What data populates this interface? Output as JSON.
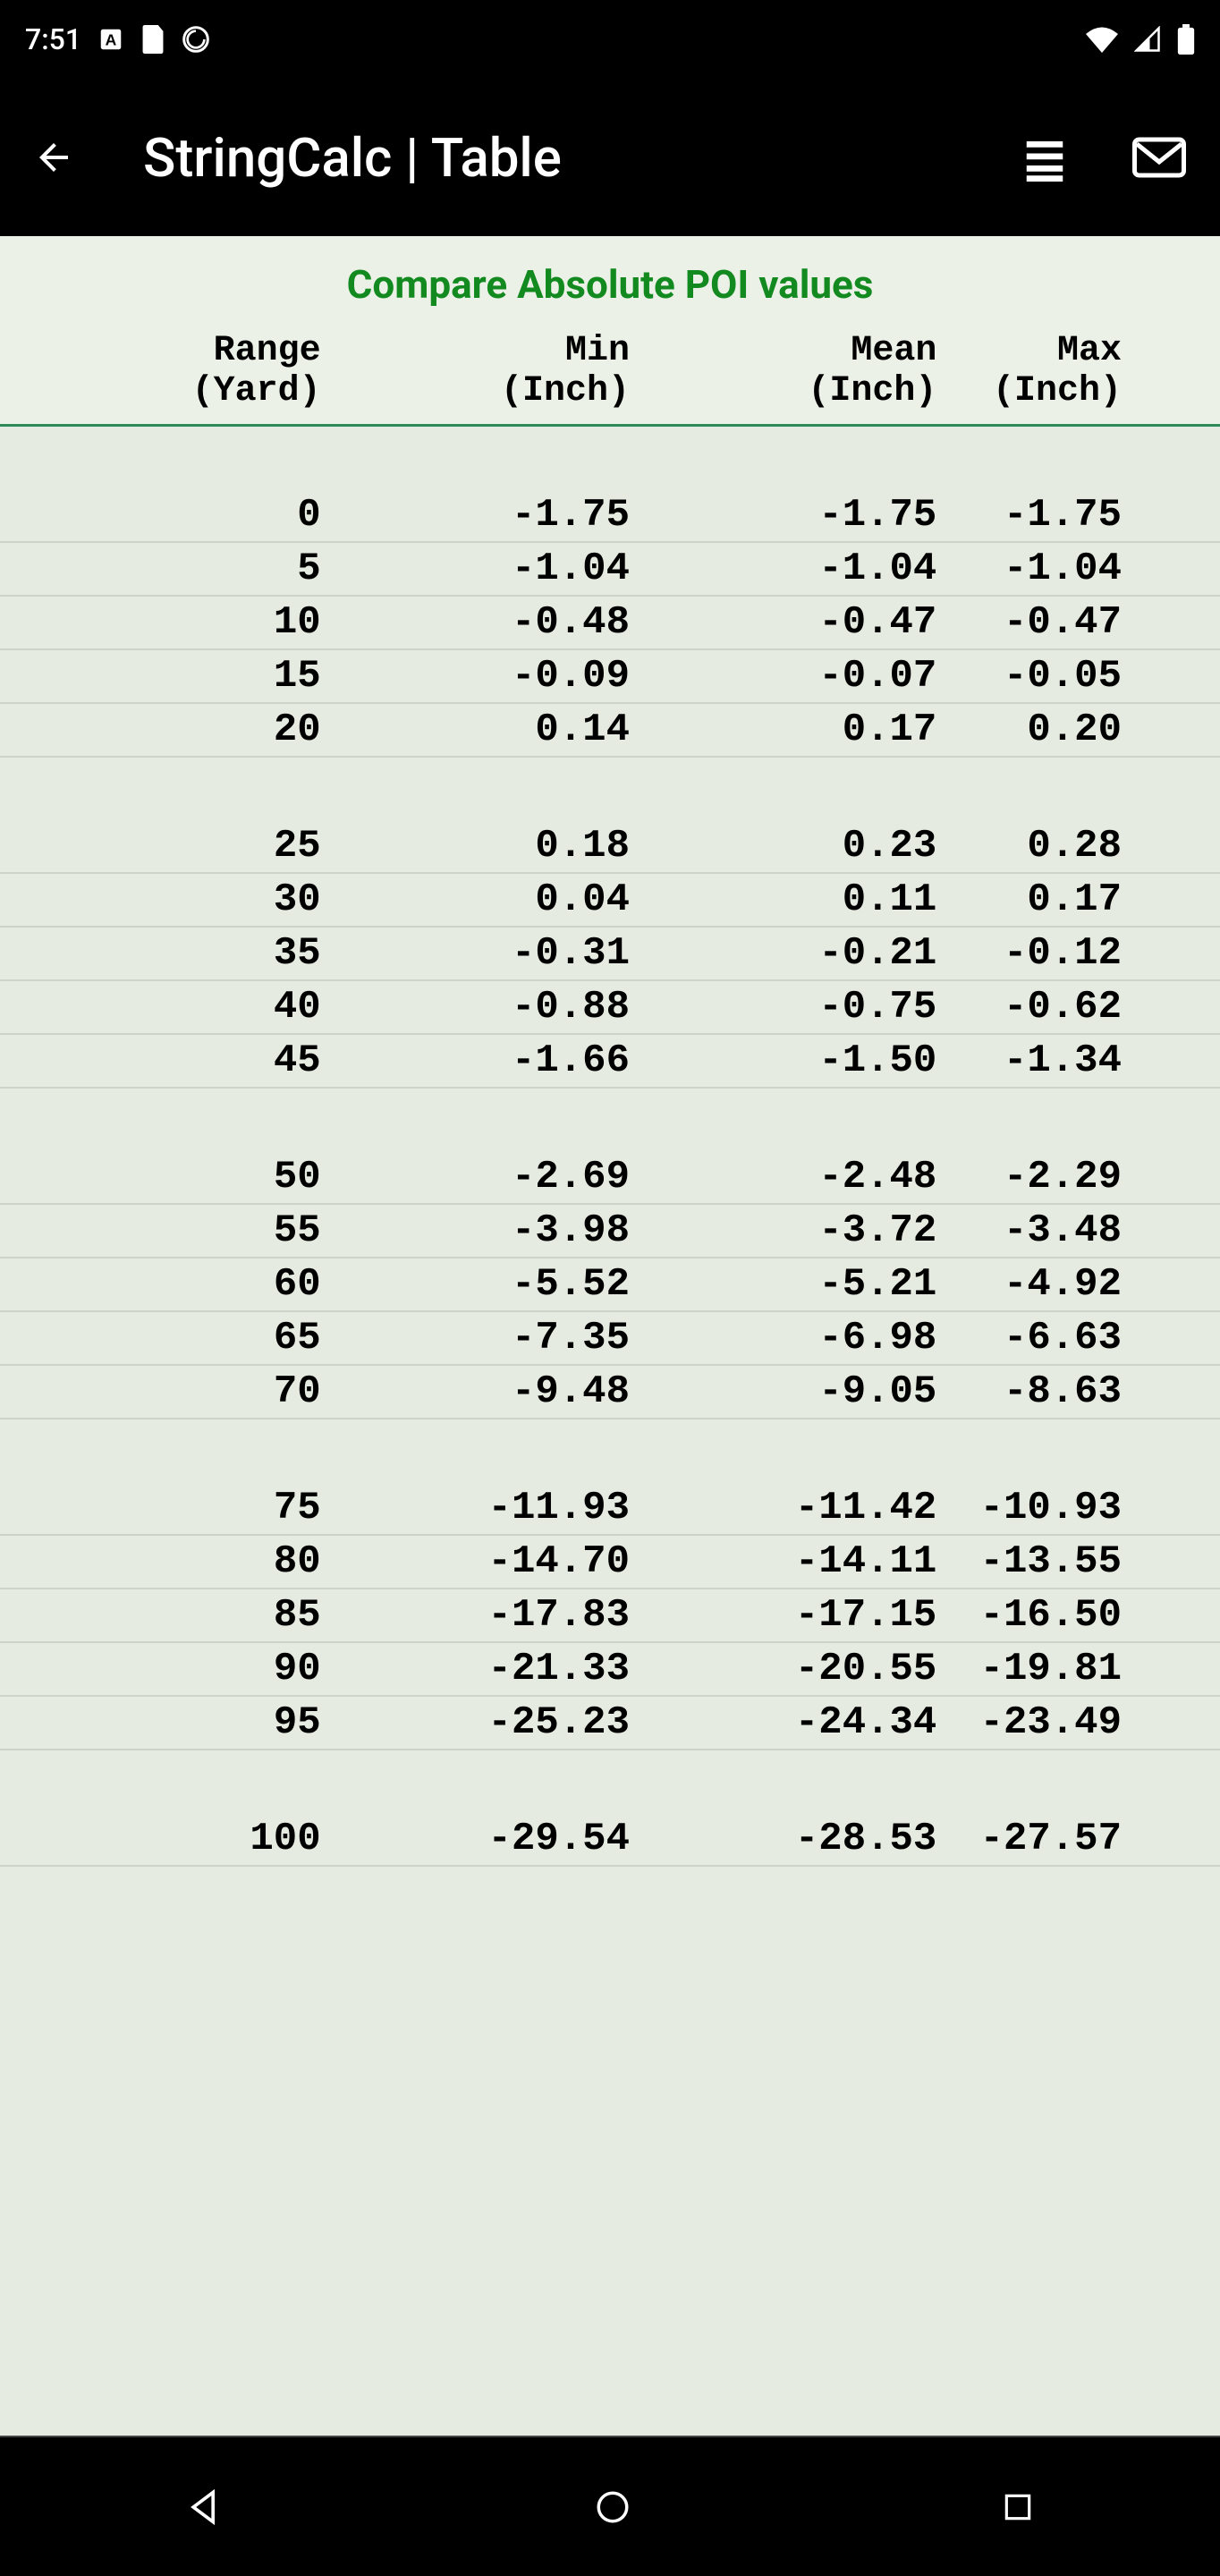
{
  "status": {
    "time": "7:51"
  },
  "appbar": {
    "title": "StringCalc | Table"
  },
  "table": {
    "title": "Compare Absolute POI values",
    "headers": [
      {
        "label": "Range",
        "unit": "(Yard)"
      },
      {
        "label": "Min",
        "unit": "(Inch)"
      },
      {
        "label": "Mean",
        "unit": "(Inch)"
      },
      {
        "label": "Max",
        "unit": "(Inch)"
      }
    ],
    "groups": [
      [
        {
          "range": "0",
          "min": "-1.75",
          "mean": "-1.75",
          "max": "-1.75"
        },
        {
          "range": "5",
          "min": "-1.04",
          "mean": "-1.04",
          "max": "-1.04"
        },
        {
          "range": "10",
          "min": "-0.48",
          "mean": "-0.47",
          "max": "-0.47"
        },
        {
          "range": "15",
          "min": "-0.09",
          "mean": "-0.07",
          "max": "-0.05"
        },
        {
          "range": "20",
          "min": "0.14",
          "mean": "0.17",
          "max": "0.20"
        }
      ],
      [
        {
          "range": "25",
          "min": "0.18",
          "mean": "0.23",
          "max": "0.28"
        },
        {
          "range": "30",
          "min": "0.04",
          "mean": "0.11",
          "max": "0.17"
        },
        {
          "range": "35",
          "min": "-0.31",
          "mean": "-0.21",
          "max": "-0.12"
        },
        {
          "range": "40",
          "min": "-0.88",
          "mean": "-0.75",
          "max": "-0.62"
        },
        {
          "range": "45",
          "min": "-1.66",
          "mean": "-1.50",
          "max": "-1.34"
        }
      ],
      [
        {
          "range": "50",
          "min": "-2.69",
          "mean": "-2.48",
          "max": "-2.29"
        },
        {
          "range": "55",
          "min": "-3.98",
          "mean": "-3.72",
          "max": "-3.48"
        },
        {
          "range": "60",
          "min": "-5.52",
          "mean": "-5.21",
          "max": "-4.92"
        },
        {
          "range": "65",
          "min": "-7.35",
          "mean": "-6.98",
          "max": "-6.63"
        },
        {
          "range": "70",
          "min": "-9.48",
          "mean": "-9.05",
          "max": "-8.63"
        }
      ],
      [
        {
          "range": "75",
          "min": "-11.93",
          "mean": "-11.42",
          "max": "-10.93"
        },
        {
          "range": "80",
          "min": "-14.70",
          "mean": "-14.11",
          "max": "-13.55"
        },
        {
          "range": "85",
          "min": "-17.83",
          "mean": "-17.15",
          "max": "-16.50"
        },
        {
          "range": "90",
          "min": "-21.33",
          "mean": "-20.55",
          "max": "-19.81"
        },
        {
          "range": "95",
          "min": "-25.23",
          "mean": "-24.34",
          "max": "-23.49"
        }
      ],
      [
        {
          "range": "100",
          "min": "-29.54",
          "mean": "-28.53",
          "max": "-27.57"
        }
      ]
    ]
  }
}
